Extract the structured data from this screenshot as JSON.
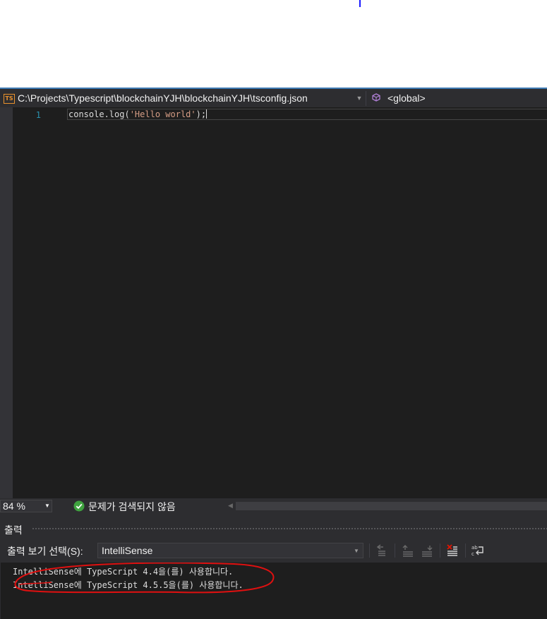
{
  "navigation": {
    "file_badge": "TS",
    "file_path": "C:\\Projects\\Typescript\\blockchainYJH\\blockchainYJH\\tsconfig.json",
    "scope": "<global>"
  },
  "editor": {
    "line_number": "1",
    "code": {
      "prefix": "console.log(",
      "string": "'Hello world'",
      "suffix": ");"
    }
  },
  "status_bar": {
    "zoom": "84 %",
    "issues_text": "문제가 검색되지 않음",
    "ok_color": "#3fa33f"
  },
  "output_panel": {
    "title": "출력",
    "source_label": "출력 보기 선택(S):",
    "source_value": "IntelliSense",
    "toolbar_icons": [
      "go-to-previous-message-icon",
      "previous-location-icon",
      "next-location-icon",
      "clear-all-icon",
      "word-wrap-icon"
    ],
    "lines": [
      "IntelliSense에 TypeScript 4.4을(를) 사용합니다.",
      "IntelliSense에 TypeScript 4.5.5을(를) 사용합니다."
    ],
    "annotation_color": "#e01010"
  }
}
